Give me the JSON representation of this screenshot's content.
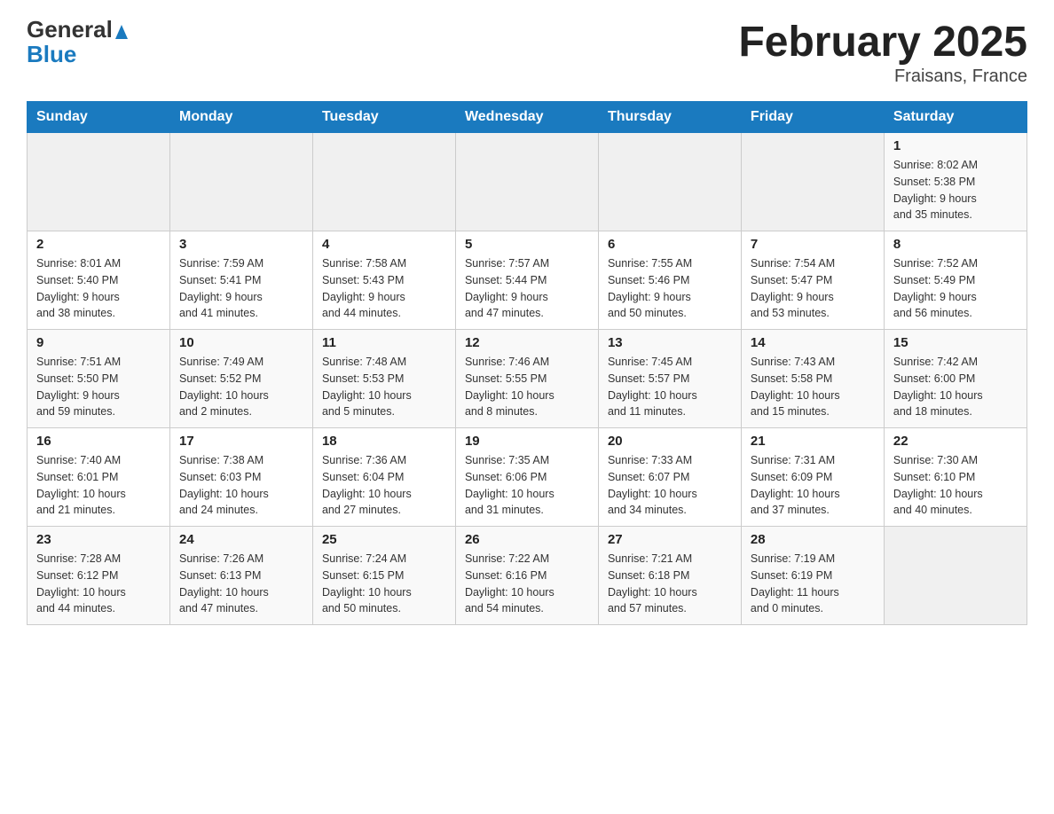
{
  "header": {
    "logo_general": "General",
    "logo_blue": "Blue",
    "month_title": "February 2025",
    "location": "Fraisans, France"
  },
  "weekdays": [
    "Sunday",
    "Monday",
    "Tuesday",
    "Wednesday",
    "Thursday",
    "Friday",
    "Saturday"
  ],
  "weeks": [
    [
      {
        "day": "",
        "info": ""
      },
      {
        "day": "",
        "info": ""
      },
      {
        "day": "",
        "info": ""
      },
      {
        "day": "",
        "info": ""
      },
      {
        "day": "",
        "info": ""
      },
      {
        "day": "",
        "info": ""
      },
      {
        "day": "1",
        "info": "Sunrise: 8:02 AM\nSunset: 5:38 PM\nDaylight: 9 hours\nand 35 minutes."
      }
    ],
    [
      {
        "day": "2",
        "info": "Sunrise: 8:01 AM\nSunset: 5:40 PM\nDaylight: 9 hours\nand 38 minutes."
      },
      {
        "day": "3",
        "info": "Sunrise: 7:59 AM\nSunset: 5:41 PM\nDaylight: 9 hours\nand 41 minutes."
      },
      {
        "day": "4",
        "info": "Sunrise: 7:58 AM\nSunset: 5:43 PM\nDaylight: 9 hours\nand 44 minutes."
      },
      {
        "day": "5",
        "info": "Sunrise: 7:57 AM\nSunset: 5:44 PM\nDaylight: 9 hours\nand 47 minutes."
      },
      {
        "day": "6",
        "info": "Sunrise: 7:55 AM\nSunset: 5:46 PM\nDaylight: 9 hours\nand 50 minutes."
      },
      {
        "day": "7",
        "info": "Sunrise: 7:54 AM\nSunset: 5:47 PM\nDaylight: 9 hours\nand 53 minutes."
      },
      {
        "day": "8",
        "info": "Sunrise: 7:52 AM\nSunset: 5:49 PM\nDaylight: 9 hours\nand 56 minutes."
      }
    ],
    [
      {
        "day": "9",
        "info": "Sunrise: 7:51 AM\nSunset: 5:50 PM\nDaylight: 9 hours\nand 59 minutes."
      },
      {
        "day": "10",
        "info": "Sunrise: 7:49 AM\nSunset: 5:52 PM\nDaylight: 10 hours\nand 2 minutes."
      },
      {
        "day": "11",
        "info": "Sunrise: 7:48 AM\nSunset: 5:53 PM\nDaylight: 10 hours\nand 5 minutes."
      },
      {
        "day": "12",
        "info": "Sunrise: 7:46 AM\nSunset: 5:55 PM\nDaylight: 10 hours\nand 8 minutes."
      },
      {
        "day": "13",
        "info": "Sunrise: 7:45 AM\nSunset: 5:57 PM\nDaylight: 10 hours\nand 11 minutes."
      },
      {
        "day": "14",
        "info": "Sunrise: 7:43 AM\nSunset: 5:58 PM\nDaylight: 10 hours\nand 15 minutes."
      },
      {
        "day": "15",
        "info": "Sunrise: 7:42 AM\nSunset: 6:00 PM\nDaylight: 10 hours\nand 18 minutes."
      }
    ],
    [
      {
        "day": "16",
        "info": "Sunrise: 7:40 AM\nSunset: 6:01 PM\nDaylight: 10 hours\nand 21 minutes."
      },
      {
        "day": "17",
        "info": "Sunrise: 7:38 AM\nSunset: 6:03 PM\nDaylight: 10 hours\nand 24 minutes."
      },
      {
        "day": "18",
        "info": "Sunrise: 7:36 AM\nSunset: 6:04 PM\nDaylight: 10 hours\nand 27 minutes."
      },
      {
        "day": "19",
        "info": "Sunrise: 7:35 AM\nSunset: 6:06 PM\nDaylight: 10 hours\nand 31 minutes."
      },
      {
        "day": "20",
        "info": "Sunrise: 7:33 AM\nSunset: 6:07 PM\nDaylight: 10 hours\nand 34 minutes."
      },
      {
        "day": "21",
        "info": "Sunrise: 7:31 AM\nSunset: 6:09 PM\nDaylight: 10 hours\nand 37 minutes."
      },
      {
        "day": "22",
        "info": "Sunrise: 7:30 AM\nSunset: 6:10 PM\nDaylight: 10 hours\nand 40 minutes."
      }
    ],
    [
      {
        "day": "23",
        "info": "Sunrise: 7:28 AM\nSunset: 6:12 PM\nDaylight: 10 hours\nand 44 minutes."
      },
      {
        "day": "24",
        "info": "Sunrise: 7:26 AM\nSunset: 6:13 PM\nDaylight: 10 hours\nand 47 minutes."
      },
      {
        "day": "25",
        "info": "Sunrise: 7:24 AM\nSunset: 6:15 PM\nDaylight: 10 hours\nand 50 minutes."
      },
      {
        "day": "26",
        "info": "Sunrise: 7:22 AM\nSunset: 6:16 PM\nDaylight: 10 hours\nand 54 minutes."
      },
      {
        "day": "27",
        "info": "Sunrise: 7:21 AM\nSunset: 6:18 PM\nDaylight: 10 hours\nand 57 minutes."
      },
      {
        "day": "28",
        "info": "Sunrise: 7:19 AM\nSunset: 6:19 PM\nDaylight: 11 hours\nand 0 minutes."
      },
      {
        "day": "",
        "info": ""
      }
    ]
  ]
}
